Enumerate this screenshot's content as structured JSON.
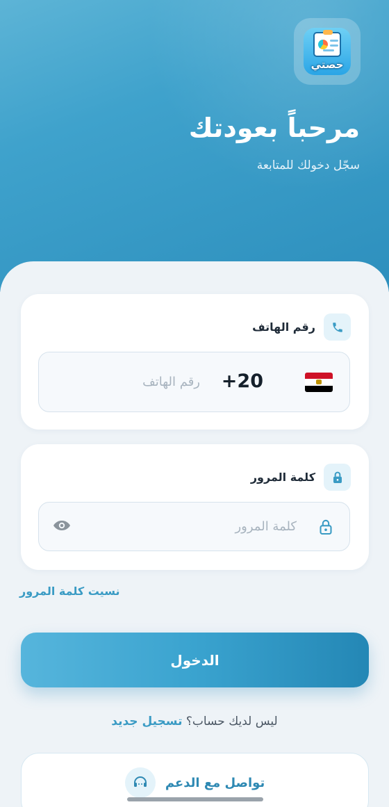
{
  "app": {
    "logo_text": "حصتي"
  },
  "header": {
    "title": "مرحباً بعودتك",
    "subtitle": "سجّل دخولك للمتابعة"
  },
  "phone_card": {
    "label": "رقم الهاتف",
    "icon": "phone-icon",
    "country_flag": "egypt-flag",
    "country_code": "+20",
    "placeholder": "رقم الهاتف",
    "value": ""
  },
  "password_card": {
    "label": "كلمة المرور",
    "icon": "lock-icon",
    "placeholder": "كلمة المرور",
    "value": "",
    "toggle_icon": "eye-icon"
  },
  "links": {
    "forgot_password": "نسيت كلمة المرور"
  },
  "buttons": {
    "login": "الدخول"
  },
  "register": {
    "prompt": "ليس لديك حساب؟",
    "link": "تسجيل جديد"
  },
  "support": {
    "label": "تواصل مع الدعم",
    "icon": "headset-icon"
  },
  "colors": {
    "primary": "#3aa3cf",
    "header_gradient_start": "#5db4d6",
    "header_gradient_end": "#2d8fbd",
    "background": "#eef3f7",
    "link": "#3a9bc4"
  }
}
